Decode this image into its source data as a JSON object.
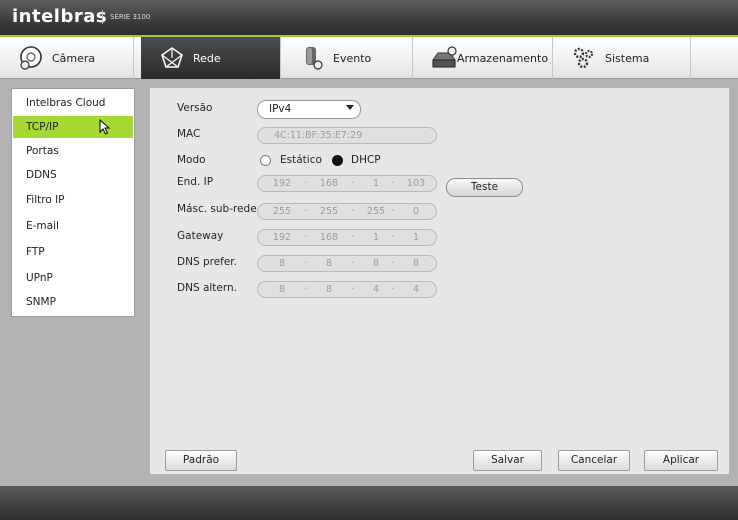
{
  "header": {
    "logo_text": "intelbras",
    "series_text": "SÉRIE 3100"
  },
  "tabs": [
    {
      "label": "Câmera",
      "icon": "camera-icon"
    },
    {
      "label": "Rede",
      "icon": "network-icon",
      "active": true
    },
    {
      "label": "Evento",
      "icon": "event-icon"
    },
    {
      "label": "Armazenamento",
      "icon": "storage-icon"
    },
    {
      "label": "Sistema",
      "icon": "gears-icon"
    }
  ],
  "sidebar": {
    "items": [
      {
        "label": "Intelbras Cloud"
      },
      {
        "label": "TCP/IP",
        "active": true
      },
      {
        "label": "Portas"
      },
      {
        "label": "DDNS"
      },
      {
        "label": "Filtro IP"
      },
      {
        "label": "E-mail"
      },
      {
        "label": "FTP"
      },
      {
        "label": "UPnP"
      },
      {
        "label": "SNMP"
      }
    ]
  },
  "form": {
    "version_label": "Versão",
    "version_value": "IPv4",
    "mac_label": "MAC",
    "mac_value": "4C:11:BF:35:E7:29",
    "mode_label": "Modo",
    "mode_static": "Estático",
    "mode_dhcp": "DHCP",
    "mode_selected": "DHCP",
    "ip_label": "End. IP",
    "ip": [
      "192",
      "168",
      "1",
      "103"
    ],
    "test_button": "Teste",
    "mask_label": "Másc. sub-rede",
    "mask": [
      "255",
      "255",
      "255",
      "0"
    ],
    "gateway_label": "Gateway",
    "gateway": [
      "192",
      "168",
      "1",
      "1"
    ],
    "dns1_label": "DNS prefer.",
    "dns1": [
      "8",
      "8",
      "8",
      "8"
    ],
    "dns2_label": "DNS altern.",
    "dns2": [
      "8",
      "8",
      "4",
      "4"
    ]
  },
  "buttons": {
    "default": "Padrão",
    "save": "Salvar",
    "cancel": "Cancelar",
    "apply": "Aplicar"
  },
  "colors": {
    "accent": "#9acd32",
    "active_side": "#a6d932",
    "active_tab": "#3a3a3a"
  }
}
